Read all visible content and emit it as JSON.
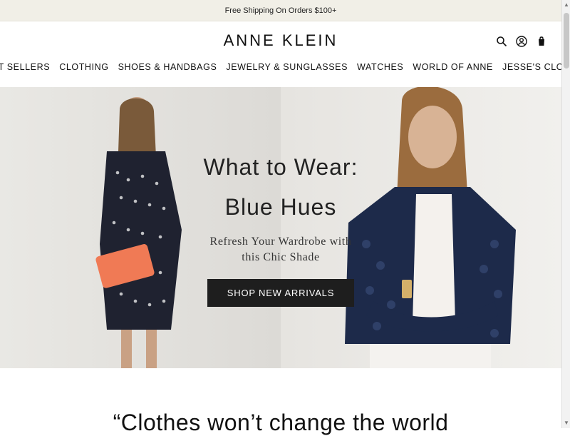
{
  "announcement": "Free Shipping On Orders $100+",
  "brand": "ANNE KLEIN",
  "header_icons": [
    "search-icon",
    "account-icon",
    "bag-icon"
  ],
  "nav": [
    "BEST SELLERS",
    "CLOTHING",
    "SHOES & HANDBAGS",
    "JEWELRY & SUNGLASSES",
    "WATCHES",
    "WORLD OF ANNE",
    "JESSE'S CLOSET"
  ],
  "hero": {
    "title_line1": "What to Wear:",
    "title_line2": "Blue Hues",
    "subtitle_line1": "Refresh Your Wardrobe with",
    "subtitle_line2": "this Chic Shade",
    "cta": "SHOP NEW ARRIVALS"
  },
  "quote_partial": "“Clothes won’t change the world"
}
